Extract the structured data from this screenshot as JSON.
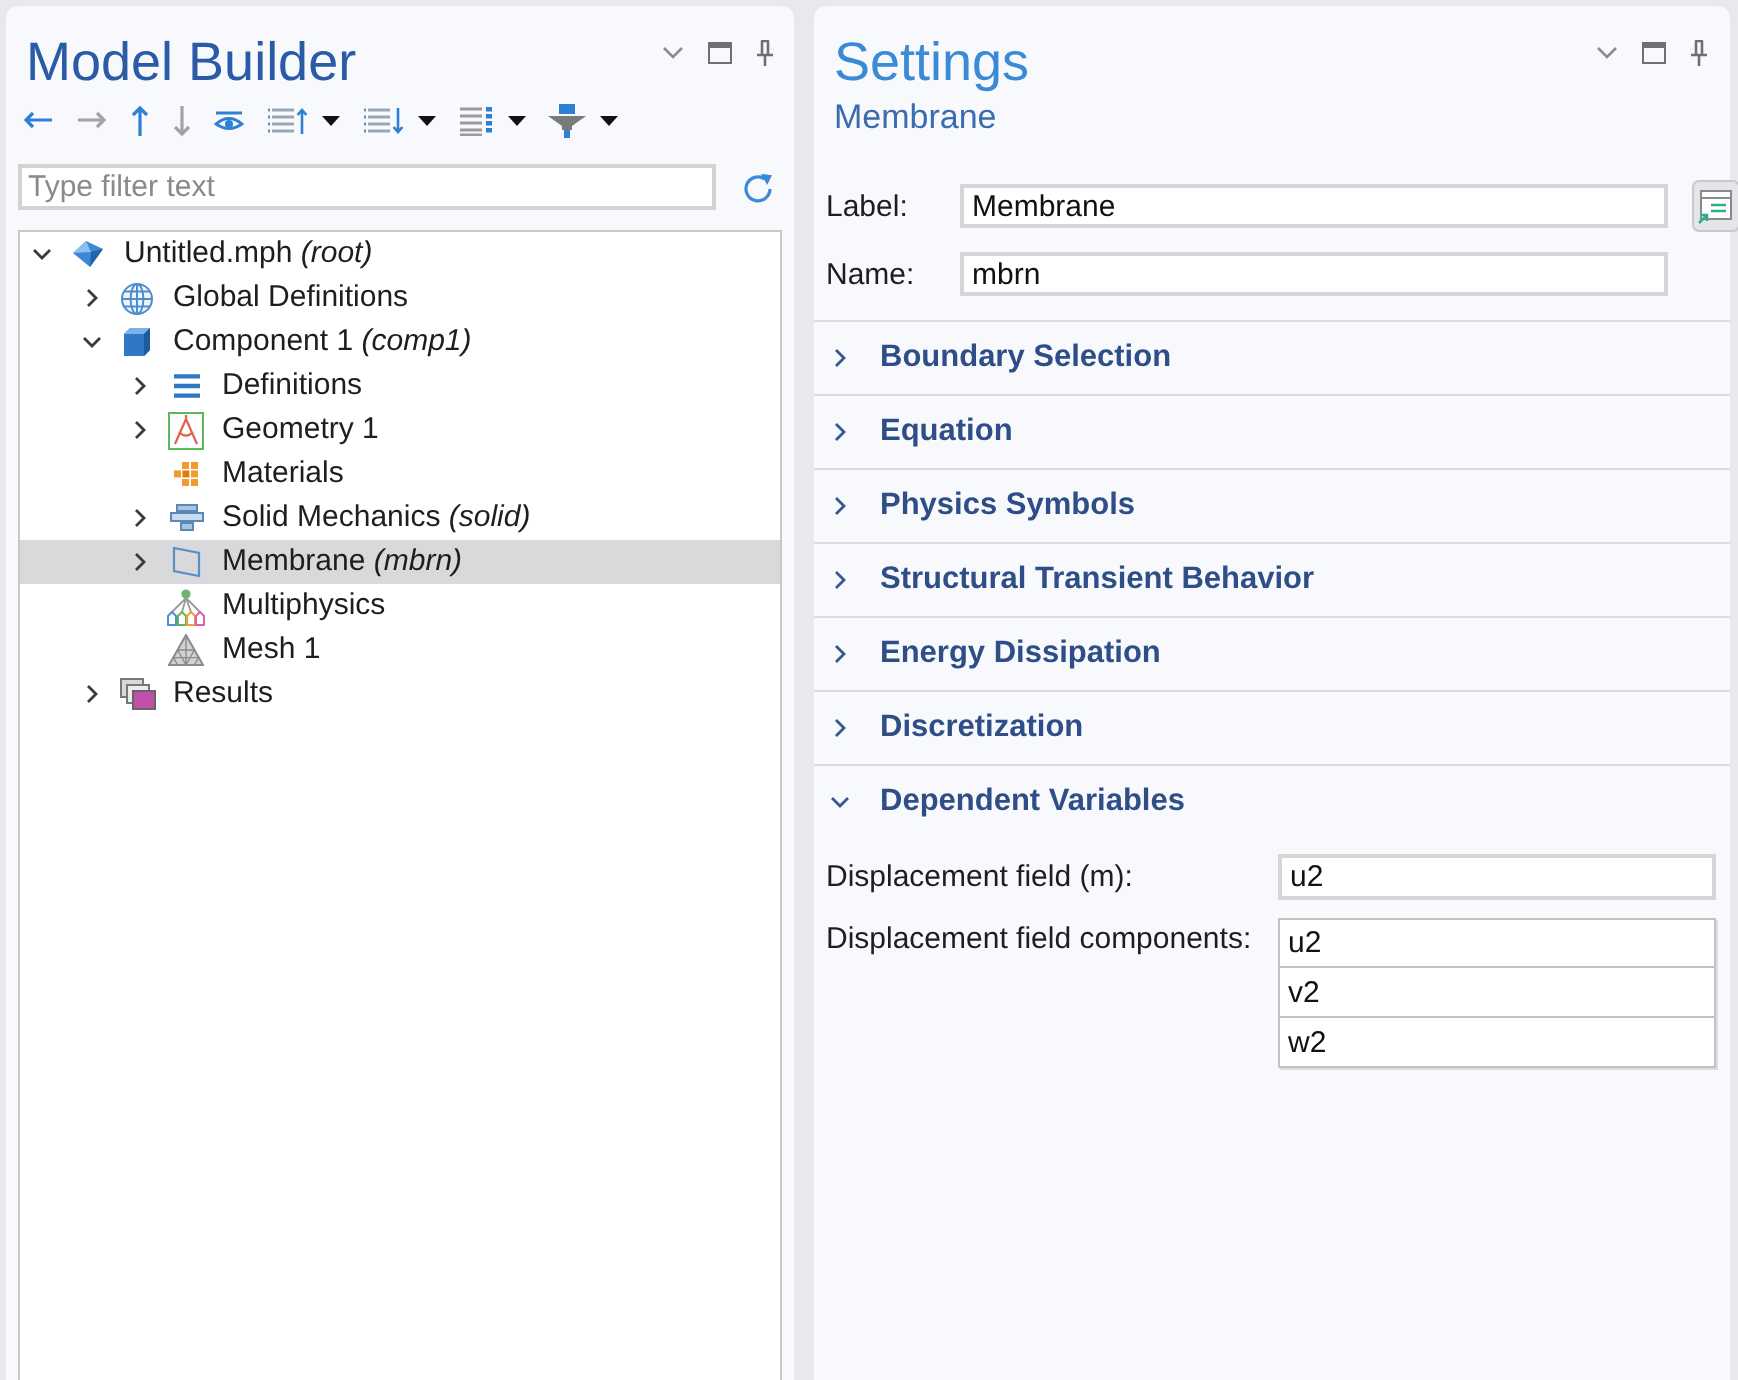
{
  "model_builder": {
    "title": "Model Builder",
    "toolbar": [
      {
        "kind": "back",
        "disabled": false,
        "dropdown": false
      },
      {
        "kind": "forward",
        "disabled": true,
        "dropdown": false
      },
      {
        "kind": "up",
        "disabled": false,
        "dropdown": false
      },
      {
        "kind": "down",
        "disabled": true,
        "dropdown": false
      },
      {
        "kind": "show",
        "disabled": false,
        "dropdown": false
      },
      {
        "kind": "moveup",
        "disabled": false,
        "dropdown": true
      },
      {
        "kind": "movedown",
        "disabled": false,
        "dropdown": true
      },
      {
        "kind": "columns",
        "disabled": false,
        "dropdown": true
      },
      {
        "kind": "filter",
        "disabled": false,
        "dropdown": true
      }
    ],
    "filter": {
      "placeholder": "Type filter text"
    },
    "tree": [
      {
        "kind": "model",
        "label": "Untitled.mph *(root)*",
        "expanded": true,
        "selected": false,
        "children": [
          {
            "kind": "global",
            "label": "Global Definitions",
            "expanded": false,
            "selected": false
          },
          {
            "kind": "component",
            "label": "Component 1 *(comp1)*",
            "expanded": true,
            "selected": false,
            "children": [
              {
                "kind": "definitions",
                "label": "Definitions",
                "expanded": false,
                "selected": false
              },
              {
                "kind": "geometry",
                "label": "Geometry 1",
                "expanded": false,
                "selected": false
              },
              {
                "kind": "materials",
                "label": "Materials",
                "selected": false
              },
              {
                "kind": "physics",
                "label": "Solid Mechanics *(solid)*",
                "expanded": false,
                "selected": false
              },
              {
                "kind": "membrane",
                "label": "Membrane *(mbrn)*",
                "expanded": false,
                "selected": true
              },
              {
                "kind": "multiphysics",
                "label": "Multiphysics",
                "selected": false
              },
              {
                "kind": "mesh",
                "label": "Mesh 1",
                "selected": false
              }
            ]
          },
          {
            "kind": "results",
            "label": "Results",
            "expanded": false,
            "selected": false
          }
        ]
      }
    ]
  },
  "settings": {
    "title": "Settings",
    "subtitle": "Membrane",
    "form": [
      {
        "caption": "Label:",
        "value": "Membrane",
        "button": true
      },
      {
        "caption": "Name:",
        "value": "mbrn",
        "button": false
      }
    ],
    "sections": [
      {
        "title": "Boundary Selection",
        "expanded": false
      },
      {
        "title": "Equation",
        "expanded": false
      },
      {
        "title": "Physics Symbols",
        "expanded": false
      },
      {
        "title": "Structural Transient Behavior",
        "expanded": false
      },
      {
        "title": "Energy Dissipation",
        "expanded": false
      },
      {
        "title": "Discretization",
        "expanded": false
      },
      {
        "title": "Dependent Variables",
        "expanded": true,
        "fields": [
          {
            "kind": "text",
            "caption": "Displacement field (m):",
            "value": "u2"
          },
          {
            "kind": "table",
            "caption": "Displacement field components:",
            "values": [
              "u2",
              "v2",
              "w2"
            ]
          }
        ]
      }
    ]
  }
}
